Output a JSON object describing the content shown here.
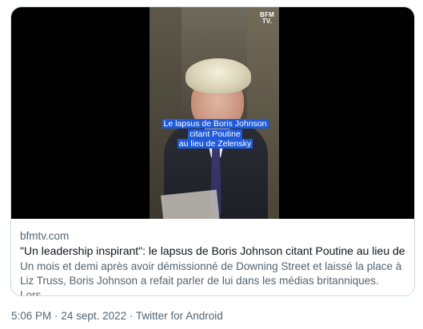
{
  "card": {
    "media": {
      "logo_line1": "BFM",
      "logo_line2": "TV.",
      "caption_lines": [
        "Le lapsus de Boris Johnson",
        "citant Poutine",
        "au lieu de Zelensky"
      ]
    },
    "domain": "bfmtv.com",
    "title": "\"Un leadership inspirant\": le lapsus de Boris Johnson citant Poutine au lieu de ...",
    "description_line1": "Un mois et demi après avoir démissionné de Downing Street et laissé la place à",
    "description_line2": "Liz Truss, Boris Johnson a refait parler de lui dans les médias britanniques. Lors..."
  },
  "tweet_meta": {
    "time": "5:06 PM",
    "date": "24 sept. 2022",
    "source": "Twitter for Android",
    "separator": "·"
  }
}
